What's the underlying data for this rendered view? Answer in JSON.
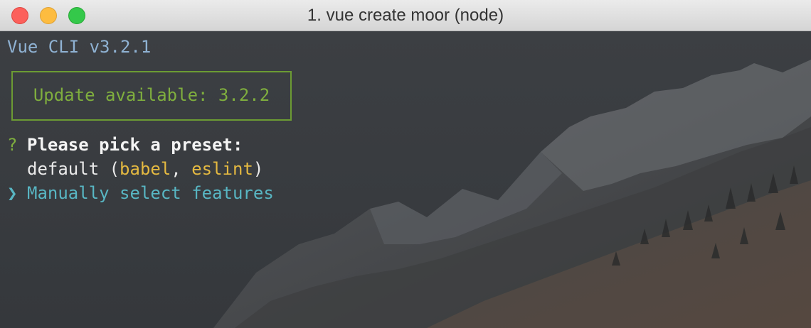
{
  "window": {
    "title": "1. vue create moor (node)"
  },
  "terminal": {
    "version_line": "Vue CLI v3.2.1",
    "update_notice": "Update available: 3.2.2",
    "prompt_marker": "?",
    "prompt_question": "Please pick a preset:",
    "options": [
      {
        "prefix": "default (",
        "tag1": "babel",
        "separator": ", ",
        "tag2": "eslint",
        "suffix": ")"
      },
      {
        "label": "Manually select features",
        "selected": true
      }
    ],
    "pointer_glyph": "❯"
  },
  "colors": {
    "background": "#3b3e42",
    "version": "#8fb2d3",
    "update": "#7fae3e",
    "highlight": "#e4b941",
    "selected": "#58b6c3"
  },
  "icons": [
    "close-light",
    "minimize-light",
    "zoom-light",
    "pointer-icon"
  ]
}
